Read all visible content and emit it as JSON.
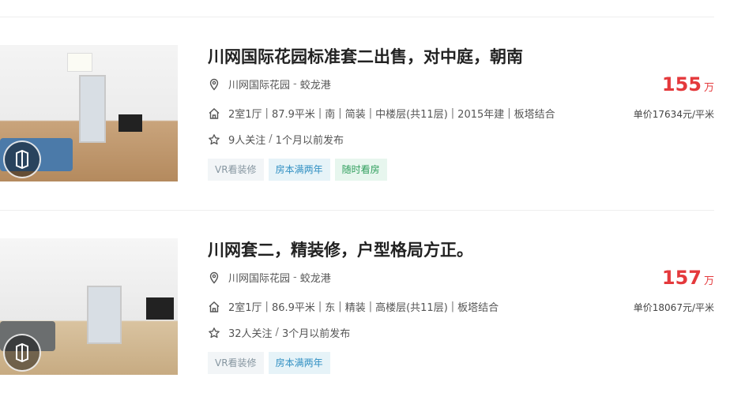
{
  "listings": [
    {
      "title": "川网国际花园标准套二出售，对中庭，朝南",
      "community": "川网国际花园",
      "area": "蛟龙港",
      "dash": "-",
      "layout": "2室1厅",
      "size": "87.9平米",
      "orientation": "南",
      "decoration": "简装",
      "floor": "中楼层(共11层)",
      "built": "2015年建",
      "structure": "板塔结合",
      "followers": "9人关注",
      "published": "1个月以前发布",
      "tags": [
        "VR看装修",
        "房本满两年",
        "随时看房"
      ],
      "price": "155",
      "price_unit": "万",
      "unit_price": "单价17634元/平米"
    },
    {
      "title": "川网套二，精装修，户型格局方正。",
      "community": "川网国际花园",
      "area": "蛟龙港",
      "dash": "-",
      "layout": "2室1厅",
      "size": "86.9平米",
      "orientation": "东",
      "decoration": "精装",
      "floor": "高楼层(共11层)",
      "built": "",
      "structure": "板塔结合",
      "followers": "32人关注",
      "published": "3个月以前发布",
      "tags": [
        "VR看装修",
        "房本满两年"
      ],
      "price": "157",
      "price_unit": "万",
      "unit_price": "单价18067元/平米"
    }
  ],
  "separator": "|",
  "slash": "/",
  "colors": {
    "price": "#e4393c",
    "tag_gray": "#8696a0",
    "tag_blue": "#2f8fc2",
    "tag_green": "#2f9e5c"
  },
  "icons": {
    "location": "location-pin-icon",
    "house": "house-icon",
    "star": "star-outline-icon",
    "vr": "vr-badge-icon"
  }
}
